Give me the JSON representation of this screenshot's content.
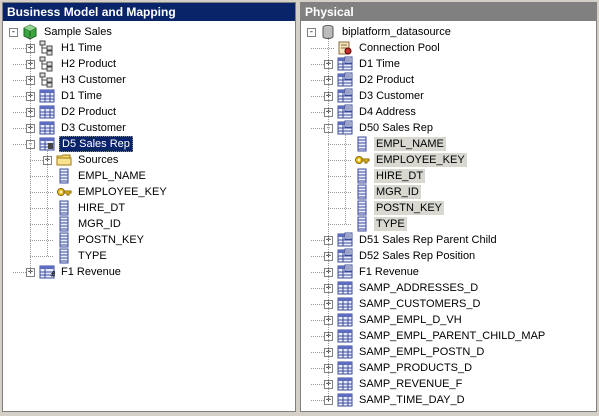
{
  "left": {
    "header": "Business Model and Mapping",
    "nodes": [
      {
        "label": "Sample Sales",
        "icon": "cube-db-icon",
        "exp": "-",
        "level": 0
      },
      {
        "label": "H1 Time",
        "icon": "hierarchy-icon",
        "exp": "+",
        "level": 1
      },
      {
        "label": "H2 Product",
        "icon": "hierarchy-icon",
        "exp": "+",
        "level": 1
      },
      {
        "label": "H3 Customer",
        "icon": "hierarchy-icon",
        "exp": "+",
        "level": 1
      },
      {
        "label": "D1 Time",
        "icon": "table-icon",
        "exp": "+",
        "level": 1
      },
      {
        "label": "D2 Product",
        "icon": "table-icon",
        "exp": "+",
        "level": 1
      },
      {
        "label": "D3 Customer",
        "icon": "table-icon",
        "exp": "+",
        "level": 1
      },
      {
        "label": "D5 Sales Rep",
        "icon": "table-hierarchy-icon",
        "exp": "-",
        "level": 1,
        "selected": true
      },
      {
        "label": "Sources",
        "icon": "folder-icon",
        "exp": "+",
        "level": 2
      },
      {
        "label": "EMPL_NAME",
        "icon": "column-icon",
        "exp": "",
        "level": 2
      },
      {
        "label": "EMPLOYEE_KEY",
        "icon": "key-icon",
        "exp": "",
        "level": 2
      },
      {
        "label": "HIRE_DT",
        "icon": "column-icon",
        "exp": "",
        "level": 2
      },
      {
        "label": "MGR_ID",
        "icon": "column-icon",
        "exp": "",
        "level": 2
      },
      {
        "label": "POSTN_KEY",
        "icon": "column-icon",
        "exp": "",
        "level": 2
      },
      {
        "label": "TYPE",
        "icon": "column-icon",
        "exp": "",
        "level": 2
      },
      {
        "label": "F1 Revenue",
        "icon": "fact-table-icon",
        "exp": "+",
        "level": 1
      }
    ]
  },
  "right": {
    "header": "Physical",
    "nodes": [
      {
        "label": "biplatform_datasource",
        "icon": "database-icon",
        "exp": "-",
        "level": 0
      },
      {
        "label": "Connection Pool",
        "icon": "connection-pool-icon",
        "exp": "",
        "level": 1
      },
      {
        "label": "D1 Time",
        "icon": "physical-table-icon",
        "exp": "+",
        "level": 1
      },
      {
        "label": "D2 Product",
        "icon": "physical-table-icon",
        "exp": "+",
        "level": 1
      },
      {
        "label": "D3 Customer",
        "icon": "physical-table-icon",
        "exp": "+",
        "level": 1
      },
      {
        "label": "D4 Address",
        "icon": "physical-table-icon",
        "exp": "+",
        "level": 1
      },
      {
        "label": "D50 Sales Rep",
        "icon": "physical-table-icon",
        "exp": "-",
        "level": 1
      },
      {
        "label": "EMPL_NAME",
        "icon": "column-icon",
        "exp": "",
        "level": 2,
        "hl": true
      },
      {
        "label": "EMPLOYEE_KEY",
        "icon": "key-icon",
        "exp": "",
        "level": 2,
        "hl": true
      },
      {
        "label": "HIRE_DT",
        "icon": "column-icon",
        "exp": "",
        "level": 2,
        "hl": true
      },
      {
        "label": "MGR_ID",
        "icon": "column-icon",
        "exp": "",
        "level": 2,
        "hl": true
      },
      {
        "label": "POSTN_KEY",
        "icon": "column-icon",
        "exp": "",
        "level": 2,
        "hl": true
      },
      {
        "label": "TYPE",
        "icon": "column-icon",
        "exp": "",
        "level": 2,
        "hl": true
      },
      {
        "label": "D51 Sales Rep Parent Child",
        "icon": "physical-table-icon",
        "exp": "+",
        "level": 1
      },
      {
        "label": "D52 Sales Rep Position",
        "icon": "physical-table-icon",
        "exp": "+",
        "level": 1
      },
      {
        "label": "F1 Revenue",
        "icon": "physical-table-icon",
        "exp": "+",
        "level": 1
      },
      {
        "label": "SAMP_ADDRESSES_D",
        "icon": "table-icon",
        "exp": "+",
        "level": 1
      },
      {
        "label": "SAMP_CUSTOMERS_D",
        "icon": "table-icon",
        "exp": "+",
        "level": 1
      },
      {
        "label": "SAMP_EMPL_D_VH",
        "icon": "table-icon",
        "exp": "+",
        "level": 1
      },
      {
        "label": "SAMP_EMPL_PARENT_CHILD_MAP",
        "icon": "table-icon",
        "exp": "+",
        "level": 1
      },
      {
        "label": "SAMP_EMPL_POSTN_D",
        "icon": "table-icon",
        "exp": "+",
        "level": 1
      },
      {
        "label": "SAMP_PRODUCTS_D",
        "icon": "table-icon",
        "exp": "+",
        "level": 1
      },
      {
        "label": "SAMP_REVENUE_F",
        "icon": "table-icon",
        "exp": "+",
        "level": 1
      },
      {
        "label": "SAMP_TIME_DAY_D",
        "icon": "table-icon",
        "exp": "+",
        "level": 1
      }
    ]
  }
}
